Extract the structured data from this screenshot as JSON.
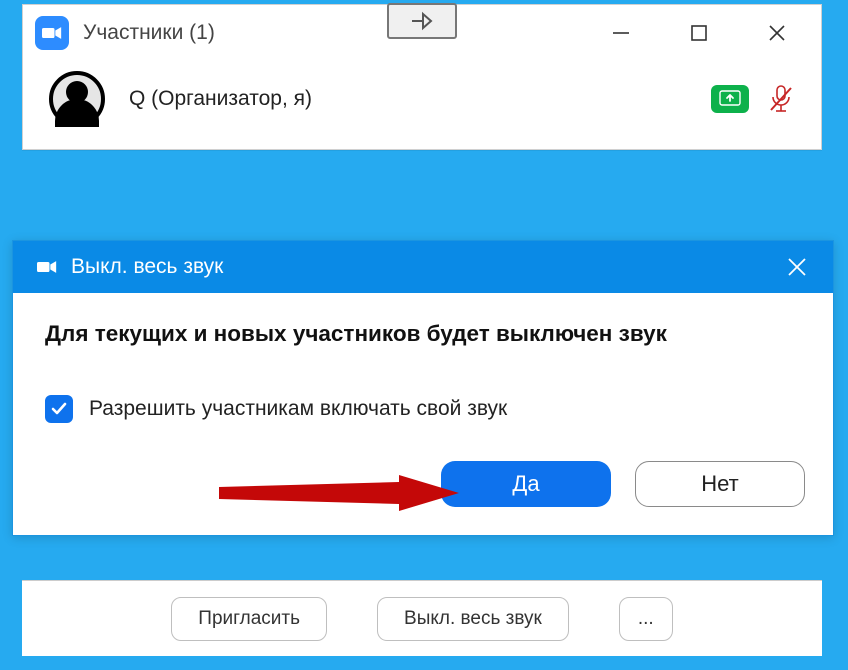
{
  "participants": {
    "title": "Участники (1)",
    "list": [
      {
        "name": "Q (Организатор, я)"
      }
    ],
    "buttons": {
      "invite": "Пригласить",
      "muteAll": "Выкл. весь звук",
      "more": "..."
    }
  },
  "dialog": {
    "title": "Выкл. весь звук",
    "heading": "Для текущих и новых участников будет выключен звук",
    "checkboxLabel": "Разрешить участникам включать свой звук",
    "checkboxChecked": true,
    "yes": "Да",
    "no": "Нет"
  }
}
